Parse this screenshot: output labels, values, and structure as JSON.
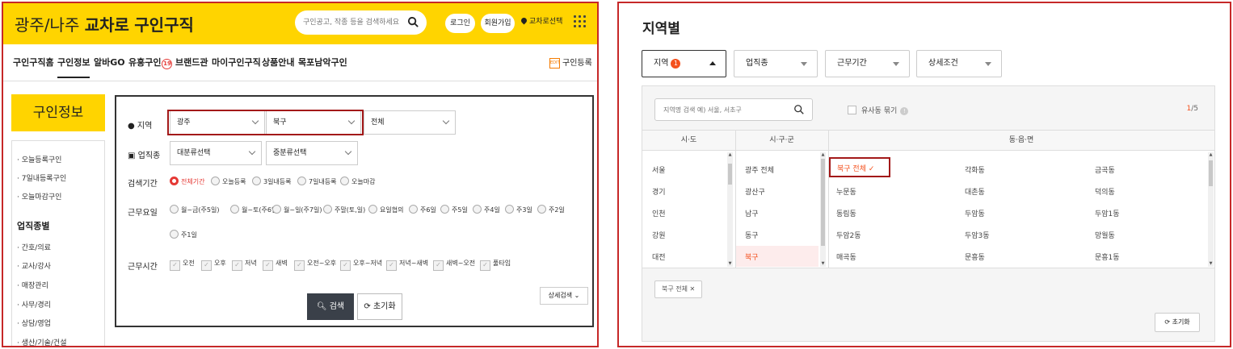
{
  "left": {
    "brand": {
      "region": "광주/나주",
      "bold": "교차로",
      "rest": "구인구직"
    },
    "search": {
      "placeholder": "구인공고, 작종 등을 검색하세요"
    },
    "header": {
      "login": "로그인",
      "join": "회원가입",
      "route": "교차로선택"
    },
    "nav": {
      "items": [
        "구인구직홈",
        "구인정보",
        "알바GO",
        "유흥구인",
        "브랜드관",
        "마이구인구직",
        "상품안내",
        "목포남악구인"
      ],
      "badge": "19",
      "register": "구인등록",
      "register_icon_text": "EDIT"
    },
    "sidebar": {
      "title": "구인정보",
      "links": [
        "오늘등록구인",
        "7일내등록구인",
        "오늘마감구인"
      ],
      "section": "업직종별",
      "categories": [
        "간호/의료",
        "교사/강사",
        "매장관리",
        "사무/경리",
        "상담/영업",
        "생산/기술/건설"
      ]
    },
    "form": {
      "region_label": "지역",
      "region_values": [
        "광주",
        "북구",
        "전체"
      ],
      "job_label": "업직종",
      "job_values": [
        "대분류선택",
        "중분류선택"
      ],
      "period_label": "검색기간",
      "period_options": [
        "전체기간",
        "오늘등록",
        "3일내등록",
        "7일내등록",
        "오늘마감"
      ],
      "days_label": "근무요일",
      "days_options": [
        "월~금(주5일)",
        "월~토(주6일)",
        "월~일(주7일)",
        "주말(토,일)",
        "요일협의",
        "주6일",
        "주5일",
        "주4일",
        "주3일",
        "주2일",
        "주1일"
      ],
      "time_label": "근무시간",
      "time_options": [
        "오전",
        "오후",
        "저녁",
        "새벽",
        "오전~오후",
        "오후~저녁",
        "저녁~새벽",
        "새벽~오전",
        "풀타임"
      ],
      "search_btn": "검색",
      "reset_btn": "초기화",
      "more_btn": "상세검색"
    }
  },
  "right": {
    "title": "지역별",
    "filters": [
      "지역",
      "업직종",
      "근무기간",
      "상세조건"
    ],
    "filter_badge": "1",
    "search": {
      "placeholder": "지역명 검색 예) 서울, 서초구"
    },
    "similar": "유사동 묶기",
    "info_icon": "!",
    "page": {
      "current": "1",
      "total": "/5"
    },
    "headers": [
      "시·도",
      "시·구·군",
      "동·읍·면"
    ],
    "sido": [
      "서울",
      "경기",
      "인천",
      "강원",
      "대전"
    ],
    "sigungu": [
      "광주 전체",
      "광산구",
      "남구",
      "동구",
      "북구"
    ],
    "dong": [
      [
        "북구 전체 ✓",
        "각화동",
        "금곡동"
      ],
      [
        "누문동",
        "대촌동",
        "덕의동"
      ],
      [
        "동림동",
        "두암동",
        "두암1동"
      ],
      [
        "두암2동",
        "두암3동",
        "망월동"
      ],
      [
        "매곡동",
        "문흥동",
        "문흥1동"
      ]
    ],
    "selected_tag": "북구 전체 ✕",
    "reset": "초기화"
  }
}
